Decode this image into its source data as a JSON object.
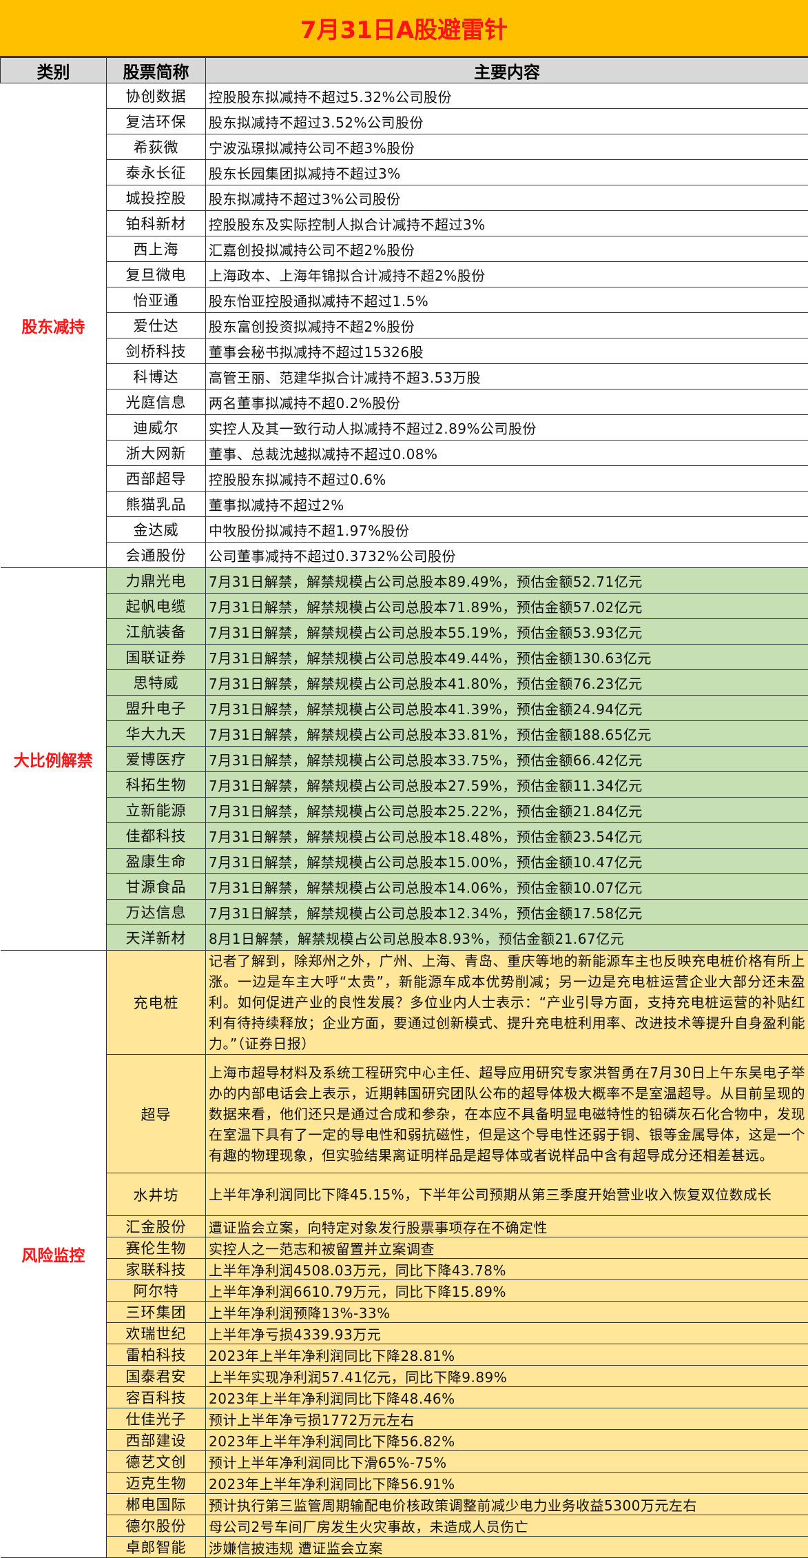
{
  "title": "7月31日A股避雷针",
  "headers": {
    "category": "类别",
    "stock": "股票简称",
    "content": "主要内容"
  },
  "colors": {
    "title_bg": "#ffc000",
    "title_text": "#ff1414",
    "group1": "#ffffff",
    "group2": "#c6e0b4",
    "group3": "#ffe699"
  },
  "groups": [
    {
      "category": "股东减持",
      "rows": [
        {
          "name": "协创数据",
          "content": "控股股东拟减持不超过5.32%公司股份"
        },
        {
          "name": "复洁环保",
          "content": "股东拟减持不超过3.52%公司股份"
        },
        {
          "name": "希荻微",
          "content": "宁波泓璟拟减持公司不超3%股份"
        },
        {
          "name": "泰永长征",
          "content": "股东长园集团拟减持不超过3%"
        },
        {
          "name": "城投控股",
          "content": "股东拟减持不超过3%公司股份"
        },
        {
          "name": "铂科新材",
          "content": "控股股东及实际控制人拟合计减持不超过3%"
        },
        {
          "name": "西上海",
          "content": "汇嘉创投拟减持公司不超2%股份"
        },
        {
          "name": "复旦微电",
          "content": "上海政本、上海年锦拟合计减持不超2%股份"
        },
        {
          "name": "怡亚通",
          "content": "股东怡亚控股通拟减持不超过1.5%"
        },
        {
          "name": "爱仕达",
          "content": "股东富创投资拟减持不超2%股份"
        },
        {
          "name": "剑桥科技",
          "content": "董事会秘书拟减持不超过15326股"
        },
        {
          "name": "科博达",
          "content": "高管王丽、范建华拟合计减持不超3.53万股"
        },
        {
          "name": "光庭信息",
          "content": "两名董事拟减持不超0.2%股份"
        },
        {
          "name": "迪威尔",
          "content": "实控人及其一致行动人拟减持不超过2.89%公司股份"
        },
        {
          "name": "浙大网新",
          "content": "董事、总裁沈越拟减持不超过0.08%"
        },
        {
          "name": "西部超导",
          "content": "控股股东拟减持不超过0.6%"
        },
        {
          "name": "熊猫乳品",
          "content": "董事拟减持不超过2%"
        },
        {
          "name": "金达威",
          "content": "中牧股份拟减持不超1.97%股份"
        },
        {
          "name": "会通股份",
          "content": "公司董事减持不超过0.3732%公司股份"
        }
      ]
    },
    {
      "category": "大比例解禁",
      "rows": [
        {
          "name": "力鼎光电",
          "content": "7月31日解禁，解禁规模占公司总股本89.49%，预估金额52.71亿元"
        },
        {
          "name": "起帆电缆",
          "content": "7月31日解禁，解禁规模占公司总股本71.89%，预估金额57.02亿元"
        },
        {
          "name": "江航装备",
          "content": "7月31日解禁，解禁规模占公司总股本55.19%，预估金额53.93亿元"
        },
        {
          "name": "国联证券",
          "content": "7月31日解禁，解禁规模占公司总股本49.44%，预估金额130.63亿元"
        },
        {
          "name": "思特威",
          "content": "7月31日解禁，解禁规模占公司总股本41.80%，预估金额76.23亿元"
        },
        {
          "name": "盟升电子",
          "content": "7月31日解禁，解禁规模占公司总股本41.39%，预估金额24.94亿元"
        },
        {
          "name": "华大九天",
          "content": "7月31日解禁，解禁规模占公司总股本33.81%，预估金额188.65亿元"
        },
        {
          "name": "爱博医疗",
          "content": "7月31日解禁，解禁规模占公司总股本33.75%，预估金额66.42亿元"
        },
        {
          "name": "科拓生物",
          "content": "7月31日解禁，解禁规模占公司总股本27.59%，预估金额11.34亿元"
        },
        {
          "name": "立新能源",
          "content": "7月31日解禁，解禁规模占公司总股本25.22%，预估金额21.84亿元"
        },
        {
          "name": "佳都科技",
          "content": "7月31日解禁，解禁规模占公司总股本18.48%，预估金额23.54亿元"
        },
        {
          "name": "盈康生命",
          "content": "7月31日解禁，解禁规模占公司总股本15.00%，预估金额10.47亿元"
        },
        {
          "name": "甘源食品",
          "content": "7月31日解禁，解禁规模占公司总股本14.06%，预估金额10.07亿元"
        },
        {
          "name": "万达信息",
          "content": "7月31日解禁，解禁规模占公司总股本12.34%，预估金额17.58亿元"
        },
        {
          "name": "天洋新材",
          "content": "8月1日解禁，解禁规模占公司总股本8.93%，预估金额21.67亿元"
        }
      ]
    },
    {
      "category": "风险监控",
      "rows": [
        {
          "name": "充电桩",
          "content": "记者了解到，除郑州之外，广州、上海、青岛、重庆等地的新能源车主也反映充电桩价格有所上涨。一边是车主大呼“太贵”，新能源车成本优势削减；另一边是充电桩运营企业大部分还未盈利。如何促进产业的良性发展？多位业内人士表示：“产业引导方面，支持充电桩运营的补贴红利有待持续释放；企业方面，要通过创新模式、提升充电桩利用率、改进技术等提升自身盈利能力。”（证券日报）"
        },
        {
          "name": "超导",
          "content": "上海市超导材料及系统工程研究中心主任、超导应用研究专家洪智勇在7月30日上午东吴电子举办的内部电话会上表示，近期韩国研究团队公布的超导体极大概率不是室温超导。从目前呈现的数据来看，他们还只是通过合成和参杂，在本应不具备明显电磁特性的铅磷灰石化合物中，发现在室温下具有了一定的导电性和弱抗磁性，但是这个导电性还弱于铜、银等金属导体，这是一个有趣的物理现象，但实验结果离证明样品是超导体或者说样品中含有超导成分还相差甚远。"
        },
        {
          "name": "水井坊",
          "content": "上半年净利润同比下降45.15%，下半年公司预期从第三季度开始营业收入恢复双位数成长"
        },
        {
          "name": "汇金股份",
          "content": "遭证监会立案，向特定对象发行股票事项存在不确定性"
        },
        {
          "name": "赛伦生物",
          "content": "实控人之一范志和被留置并立案调查"
        },
        {
          "name": "家联科技",
          "content": "上半年净利润4508.03万元，同比下降43.78%"
        },
        {
          "name": "阿尔特",
          "content": "上半年净利润6610.79万元，同比下降15.89%"
        },
        {
          "name": "三环集团",
          "content": "上半年净利润预降13%-33%"
        },
        {
          "name": "欢瑞世纪",
          "content": "上半年净亏损4339.93万元"
        },
        {
          "name": "雷柏科技",
          "content": "2023年上半年净利润同比下降28.81%"
        },
        {
          "name": "国泰君安",
          "content": "上半年实现净利润57.41亿元，同比下降9.89%"
        },
        {
          "name": "容百科技",
          "content": "2023年上半年净利润同比下降48.46%"
        },
        {
          "name": "仕佳光子",
          "content": "预计上半年净亏损1772万元左右"
        },
        {
          "name": "西部建设",
          "content": "2023年上半年净利润同比下降56.82%"
        },
        {
          "name": "德艺文创",
          "content": "预计上半年净利润同比下滑65%-75%"
        },
        {
          "name": "迈克生物",
          "content": "2023年上半年净利润同比下降56.91%"
        },
        {
          "name": "郴电国际",
          "content": "预计执行第三监管周期输配电价核政策调整前减少电力业务收益5300万元左右"
        },
        {
          "name": "德尔股份",
          "content": "母公司2号车间厂房发生火灾事故，未造成人员伤亡"
        },
        {
          "name": "卓郎智能",
          "content": "涉嫌信披违规 遭证监会立案"
        }
      ]
    }
  ]
}
